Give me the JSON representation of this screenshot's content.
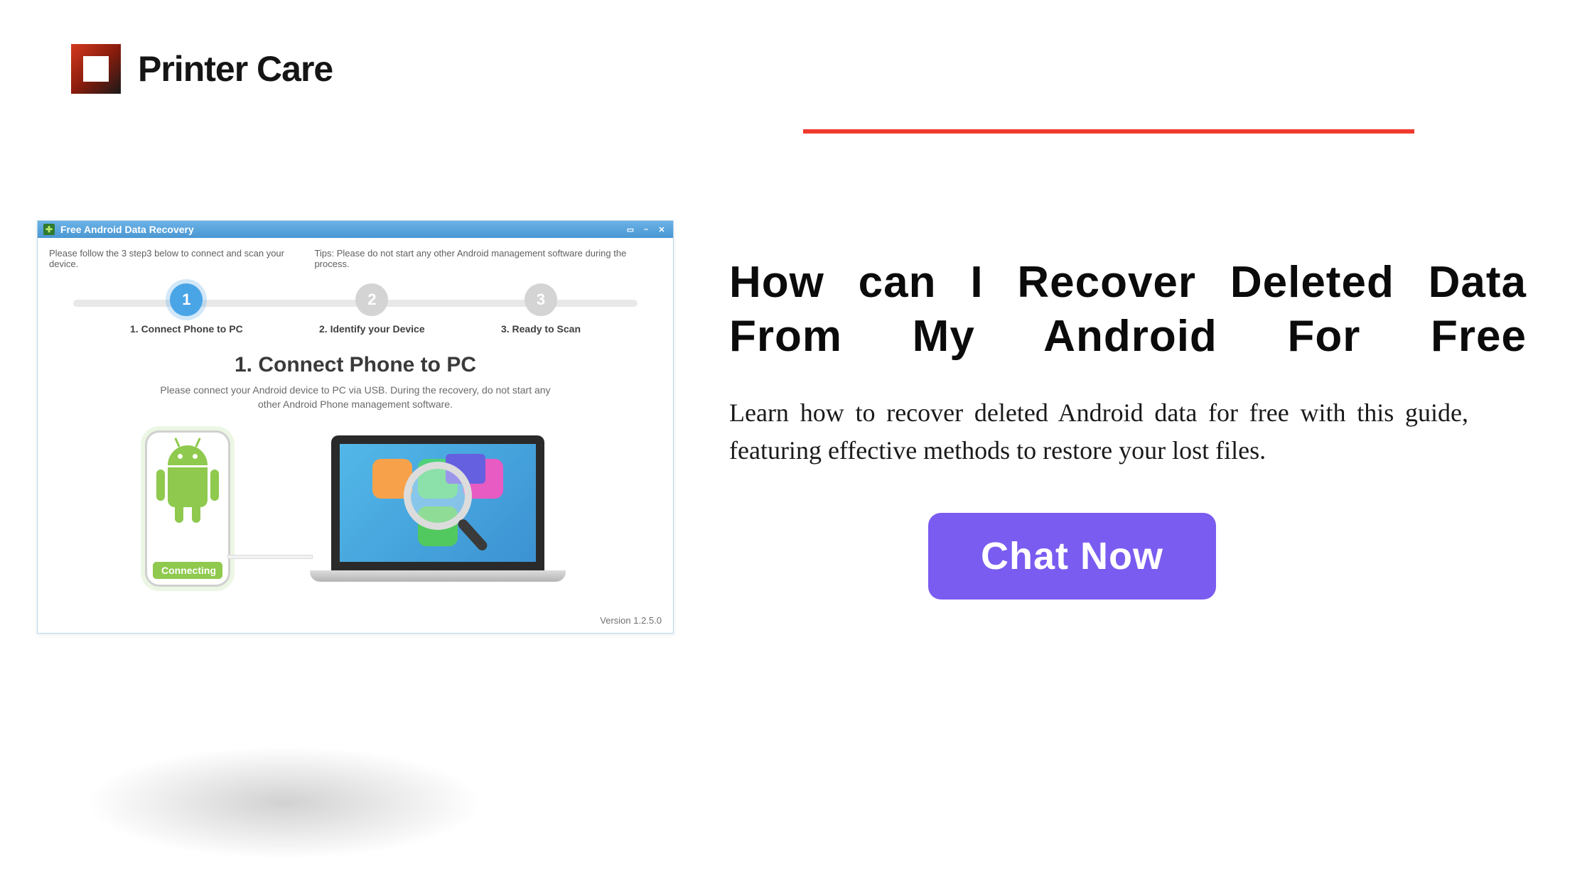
{
  "brand": {
    "name": "Printer Care"
  },
  "app_window": {
    "title": "Free Android Data Recovery",
    "instruction_left": "Please follow the 3 step3 below to connect and scan your device.",
    "instruction_right": "Tips: Please do not start any other Android management software during the process.",
    "steps": [
      {
        "num": "1",
        "label": "1. Connect Phone to PC",
        "active": true
      },
      {
        "num": "2",
        "label": "2. Identify your Device",
        "active": false
      },
      {
        "num": "3",
        "label": "3. Ready to Scan",
        "active": false
      }
    ],
    "section_title": "1. Connect Phone to PC",
    "section_desc": "Please connect your Android device to PC via USB. During the recovery, do not start any other Android Phone management software.",
    "phone_status": "Connecting",
    "version": "Version 1.2.5.0"
  },
  "article": {
    "headline": "How can I Recover Deleted Data From My Android For Free",
    "subtext": "Learn how to recover deleted Android data for free with this guide, featuring effective methods to restore your lost files.",
    "cta": "Chat Now"
  },
  "colors": {
    "accent_red": "#f03a2e",
    "cta_purple": "#7a5cf0",
    "android_green": "#8fc94e",
    "step_active": "#4aa5e6"
  }
}
